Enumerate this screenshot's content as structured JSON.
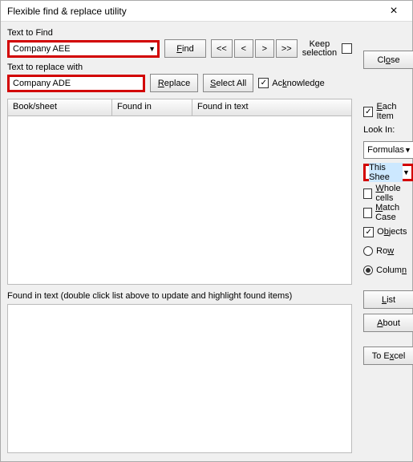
{
  "title": "Flexible find & replace utility",
  "labels": {
    "find": "Text to Find",
    "replaceWith": "Text to replace with",
    "foundInText": "Found in text (double click list above to update and highlight found items)",
    "keep1": "Keep",
    "keep2": "selection",
    "lookIn": "Look In:"
  },
  "fields": {
    "find": "Company AEE",
    "replace": "Company ADE"
  },
  "buttons": {
    "find": "Find",
    "navFirst": "<<",
    "navPrev": "<",
    "navNext": ">",
    "navLast": ">>",
    "close": "Close",
    "replace": "Replace",
    "selectAll": "Select All",
    "list": "List",
    "about": "About",
    "toExcel": "To Excel"
  },
  "checkboxes": {
    "acknowledge": "Acknowledge",
    "eachItem": "Each Item",
    "wholeCells": "Whole cells",
    "matchCase": "Match Case",
    "objects": "Objects"
  },
  "radios": {
    "row": "Row",
    "column": "Column"
  },
  "gridHeaders": {
    "book": "Book/sheet",
    "foundIn": "Found in",
    "foundText": "Found in text"
  },
  "dropdowns": {
    "lookIn": "Formulas",
    "sheet": "This Shee"
  }
}
